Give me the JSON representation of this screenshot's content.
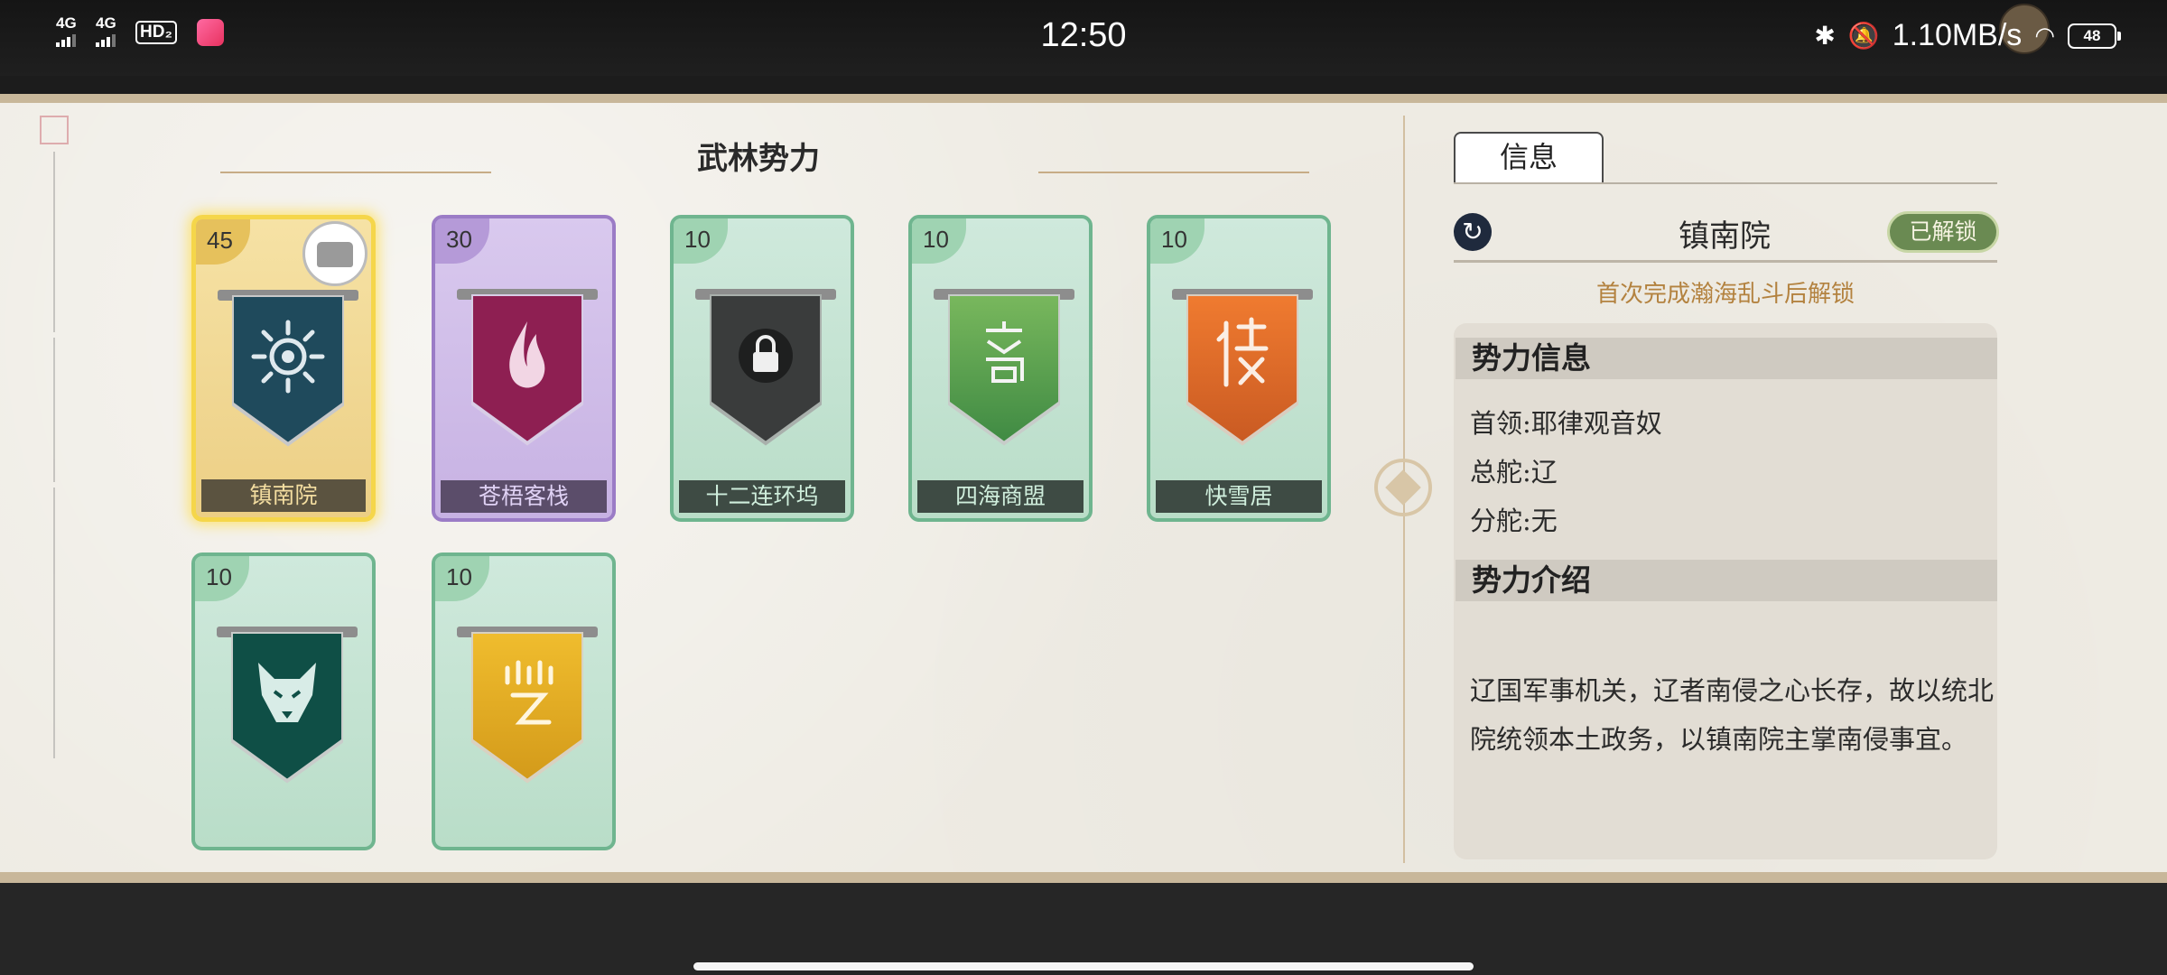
{
  "status_bar": {
    "net1": "4G",
    "net2": "4G",
    "hd": "HD₂",
    "time": "12:50",
    "speed": "1.10MB/s",
    "battery": "48"
  },
  "page": {
    "title": "武林势力"
  },
  "factions": [
    {
      "name": "镇南院",
      "cost": "45",
      "style": "gold",
      "banner_color": "#1f4a5c",
      "emblem": "sun-emblem-icon"
    },
    {
      "name": "苍梧客栈",
      "cost": "30",
      "style": "purple",
      "banner_color": "#8e1f52",
      "emblem": "flame-emblem-icon"
    },
    {
      "name": "十二连环坞",
      "cost": "10",
      "style": "green",
      "banner_color": "#3a3c3c",
      "emblem": "lock-icon"
    },
    {
      "name": "四海商盟",
      "cost": "10",
      "style": "green",
      "banner_color": "#4f9a4a",
      "emblem": "seal-glyph-icon"
    },
    {
      "name": "快雪居",
      "cost": "10",
      "style": "green",
      "banner_color": "#d86a2a",
      "emblem": "seal-glyph-icon"
    },
    {
      "name": "",
      "cost": "10",
      "style": "green",
      "banner_color": "#0f4f46",
      "emblem": "wolf-emblem-icon"
    },
    {
      "name": "",
      "cost": "10",
      "style": "green",
      "banner_color": "#e0a824",
      "emblem": "seal-glyph-icon"
    }
  ],
  "detail": {
    "tab_label": "信息",
    "faction_name": "镇南院",
    "status_label": "已解锁",
    "unlock_condition": "首次完成瀚海乱斗后解锁",
    "info_heading": "势力信息",
    "leader": "首领:耶律观音奴",
    "hq": "总舵:辽",
    "branch": "分舵:无",
    "intro_heading": "势力介绍",
    "intro_text": "辽国军事机关，辽者南侵之心长存，故以统北院统领本土政务，以镇南院主掌南侵事宜。"
  },
  "colors": {
    "accent_gold": "#f5d64a",
    "unlock_text": "#b3823f",
    "unlocked_badge": "#6a8a52"
  }
}
